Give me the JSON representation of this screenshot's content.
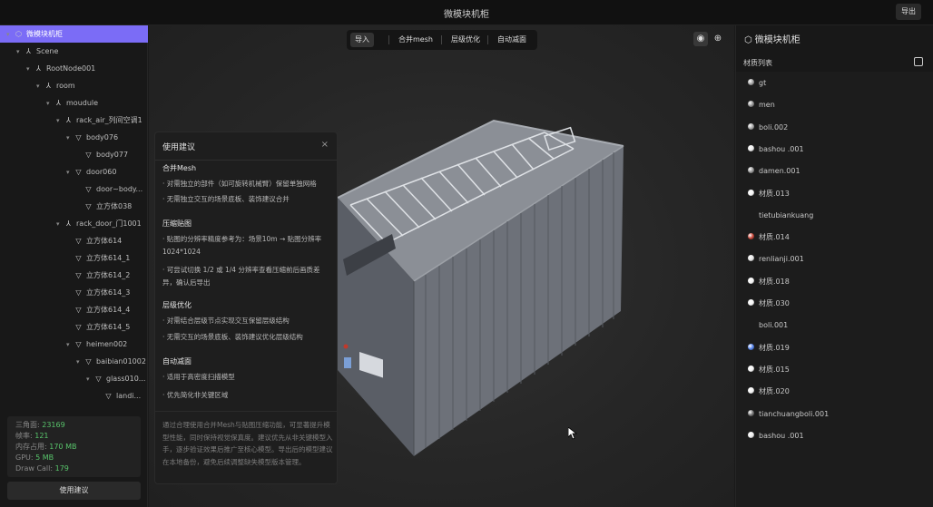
{
  "window": {
    "title": "微模块机柜",
    "export_label": "导出"
  },
  "tree": [
    {
      "label": "微模块机柜",
      "depth": 0,
      "arrow": "▾",
      "icon": "cube",
      "selected": true
    },
    {
      "label": "Scene",
      "depth": 1,
      "arrow": "▾",
      "icon": "node"
    },
    {
      "label": "RootNode001",
      "depth": 2,
      "arrow": "▾",
      "icon": "node"
    },
    {
      "label": "room",
      "depth": 3,
      "arrow": "▾",
      "icon": "node"
    },
    {
      "label": "moudule",
      "depth": 4,
      "arrow": "▾",
      "icon": "node"
    },
    {
      "label": "rack_air_列间空调1",
      "depth": 5,
      "arrow": "▾",
      "icon": "node"
    },
    {
      "label": "body076",
      "depth": 6,
      "arrow": "▾",
      "icon": "mesh"
    },
    {
      "label": "body077",
      "depth": 7,
      "arrow": "",
      "icon": "mesh"
    },
    {
      "label": "door060",
      "depth": 6,
      "arrow": "▾",
      "icon": "mesh"
    },
    {
      "label": "door~body...",
      "depth": 7,
      "arrow": "",
      "icon": "mesh"
    },
    {
      "label": "立方体038",
      "depth": 7,
      "arrow": "",
      "icon": "mesh"
    },
    {
      "label": "rack_door_门1001",
      "depth": 5,
      "arrow": "▾",
      "icon": "node"
    },
    {
      "label": "立方体614",
      "depth": 6,
      "arrow": "",
      "icon": "mesh"
    },
    {
      "label": "立方体614_1",
      "depth": 6,
      "arrow": "",
      "icon": "mesh"
    },
    {
      "label": "立方体614_2",
      "depth": 6,
      "arrow": "",
      "icon": "mesh"
    },
    {
      "label": "立方体614_3",
      "depth": 6,
      "arrow": "",
      "icon": "mesh"
    },
    {
      "label": "立方体614_4",
      "depth": 6,
      "arrow": "",
      "icon": "mesh"
    },
    {
      "label": "立方体614_5",
      "depth": 6,
      "arrow": "",
      "icon": "mesh"
    },
    {
      "label": "heimen002",
      "depth": 6,
      "arrow": "▾",
      "icon": "mesh"
    },
    {
      "label": "baibian01002",
      "depth": 7,
      "arrow": "▾",
      "icon": "mesh"
    },
    {
      "label": "glass010...",
      "depth": 8,
      "arrow": "▾",
      "icon": "mesh"
    },
    {
      "label": "landi...",
      "depth": 9,
      "arrow": "",
      "icon": "mesh"
    }
  ],
  "stats": {
    "triangles_label": "三角面:",
    "triangles": "23169",
    "fps_label": "帧率:",
    "fps": "121",
    "mem_label": "内存占用:",
    "mem": "170 MB",
    "gpu_label": "GPU:",
    "gpu": "5 MB",
    "drawcall_label": "Draw Call:",
    "drawcall": "179"
  },
  "advice_button": "使用建议",
  "toolbar": {
    "import": "导入",
    "merge": "合并mesh",
    "lod": "层级优化",
    "reduce": "自动减面"
  },
  "advice": {
    "title": "使用建议",
    "close": "×",
    "sections": [
      {
        "title": "合并Mesh",
        "items": [
          "· 对需独立的部件（如可旋转机械臂）保留单独网格",
          "· 无需独立交互的场景底板、装饰建议合并"
        ]
      },
      {
        "title": "压缩贴图",
        "items": [
          "· 贴图的分辨率精度参考为：场景10m → 贴图分辨率1024*1024",
          "· 可尝试切换 1/2 或 1/4 分辨率查看压缩前后画质差异，确认后导出"
        ]
      },
      {
        "title": "层级优化",
        "items": [
          "· 对需结合层级节点实现交互保留层级结构",
          "· 无需交互的场景底板、装饰建议优化层级结构"
        ]
      },
      {
        "title": "自动减面",
        "items": [
          "· 适用于高密度扫描模型",
          "· 优先简化非关键区域"
        ]
      }
    ],
    "footer": "通过合理使用合并Mesh与贴图压缩功能，可显著提升模型性能，同时保持视觉保真度。建议优先从非关键模型入手，逐步验证效果后推广至核心模型。导出后的模型建议在本地备份，避免后续调整缺失模型版本管理。"
  },
  "right": {
    "title": "微模块机柜",
    "subtitle": "材质列表",
    "materials": [
      {
        "name": "gt",
        "color": "#9a9a9a"
      },
      {
        "name": "men",
        "color": "#8a8a8a"
      },
      {
        "name": "boli.002",
        "color": "#a0a0a0"
      },
      {
        "name": "bashou .001",
        "color": "#e8e8e8"
      },
      {
        "name": "damen.001",
        "color": "#909090"
      },
      {
        "name": "材质.013",
        "color": "#f2f2f2"
      },
      {
        "name": "tietubiankuang",
        "color": ""
      },
      {
        "name": "材质.014",
        "color": "#c0392b"
      },
      {
        "name": "renlianji.001",
        "color": "#e0e0e0"
      },
      {
        "name": "材质.018",
        "color": "#f2f2f2"
      },
      {
        "name": "材质.030",
        "color": "#f2f2f2"
      },
      {
        "name": "boli.001",
        "color": ""
      },
      {
        "name": "材质.019",
        "color": "#4a7be8"
      },
      {
        "name": "材质.015",
        "color": "#f2f2f2"
      },
      {
        "name": "材质.020",
        "color": "#f2f2f2"
      },
      {
        "name": "tianchuangboli.001",
        "color": "#6a6a6a"
      },
      {
        "name": "bashou .001",
        "color": "#e8e8e8"
      }
    ]
  }
}
